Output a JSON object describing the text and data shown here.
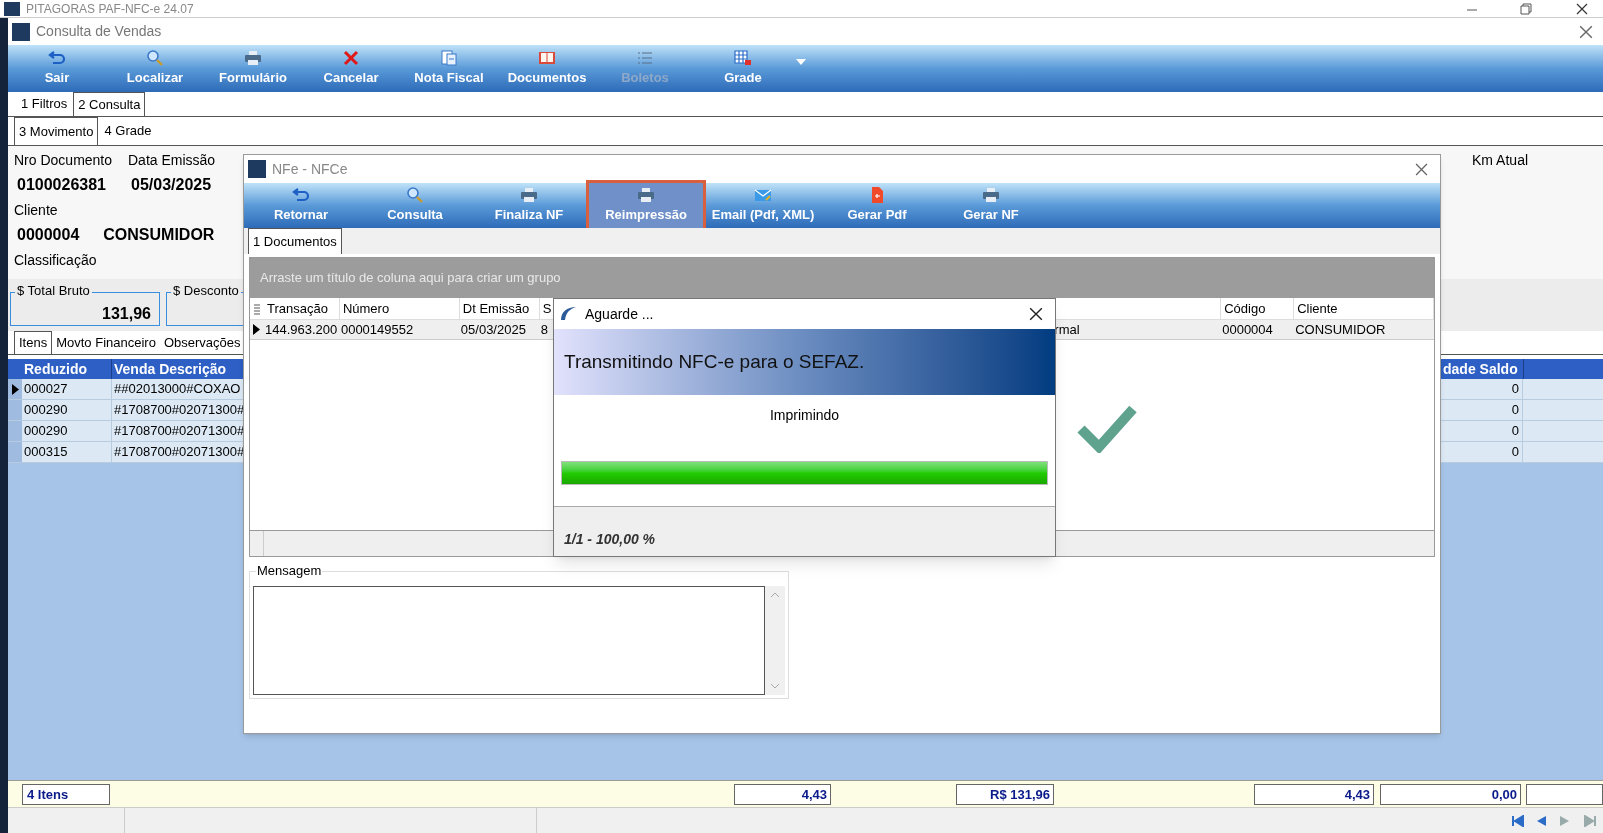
{
  "app_title_bar": {
    "title": "PITAGORAS PAF-NFC-e 24.07"
  },
  "window": {
    "title": "Consulta de Vendas"
  },
  "toolbar": [
    {
      "label": "Sair",
      "kind": "undo",
      "disabled": false
    },
    {
      "label": "Localizar",
      "kind": "search",
      "disabled": false
    },
    {
      "label": "Formulário",
      "kind": "printer",
      "disabled": false
    },
    {
      "label": "Cancelar",
      "kind": "cross",
      "disabled": false
    },
    {
      "label": "Nota Fiscal",
      "kind": "document",
      "disabled": false
    },
    {
      "label": "Documentos",
      "kind": "book",
      "disabled": false
    },
    {
      "label": "Boletos",
      "kind": "list",
      "disabled": true
    },
    {
      "label": "Grade",
      "kind": "grid",
      "disabled": false
    }
  ],
  "tabs": [
    {
      "label": "1 Filtros",
      "selected": false
    },
    {
      "label": "2 Consulta",
      "selected": true
    }
  ],
  "subtabs": [
    {
      "label": "3 Movimento",
      "selected": true
    },
    {
      "label": "4 Grade",
      "selected": false
    }
  ],
  "document": {
    "nro_label": "Nro Documento",
    "nro_value": "0100026381",
    "data_label": "Data Emissão",
    "data_value": "05/03/2025",
    "cliente_label": "Cliente",
    "cliente_code": "0000004",
    "cliente_name": "CONSUMIDOR",
    "classificacao_label": "Classificação",
    "km_label": "Km Atual"
  },
  "totals": [
    {
      "label": "$ Total Bruto",
      "value": "131,96"
    },
    {
      "label": "$ Desconto"
    }
  ],
  "item_tabs": [
    {
      "label": "Itens",
      "selected": true
    },
    {
      "label": "Movto Financeiro",
      "selected": false
    },
    {
      "label": "Observações",
      "selected": false
    }
  ],
  "items_grid": {
    "columns": [
      "Reduzido",
      "Venda Descrição",
      "dade Saldo"
    ],
    "rows": [
      {
        "selected": true,
        "reduzido": "000027",
        "descricao": "##02013000#COXAO",
        "saldo": "0"
      },
      {
        "selected": false,
        "reduzido": "000290",
        "descricao": "#1708700#02071300#",
        "saldo": "0"
      },
      {
        "selected": false,
        "reduzido": "000290",
        "descricao": "#1708700#02071300#",
        "saldo": "0"
      },
      {
        "selected": false,
        "reduzido": "000315",
        "descricao": "#1708700#02071300#",
        "saldo": "0"
      }
    ]
  },
  "footer_totals": [
    "4 Itens",
    "4,43",
    "R$ 131,96",
    "4,43",
    "0,00"
  ],
  "nfe_dialog": {
    "title": "NFe - NFCe",
    "toolbar": [
      {
        "label": "Retornar",
        "kind": "undo",
        "highlighted": false
      },
      {
        "label": "Consulta",
        "kind": "search",
        "highlighted": false
      },
      {
        "label": "Finaliza NF",
        "kind": "printer",
        "highlighted": false
      },
      {
        "label": "Reimpressão",
        "kind": "printer",
        "highlighted": true
      },
      {
        "label": "Email (Pdf, XML)",
        "kind": "mail",
        "highlighted": false
      },
      {
        "label": "Gerar Pdf",
        "kind": "pdf",
        "highlighted": false
      },
      {
        "label": "Gerar NF",
        "kind": "printer",
        "highlighted": false
      }
    ],
    "tabs": [
      {
        "label": "1 Documentos",
        "selected": true
      }
    ],
    "group_hint": "Arraste um título de coluna aqui para criar um grupo",
    "columns": [
      "Transação",
      "Número",
      "Dt Emissão",
      "S",
      "",
      "Código",
      "Cliente"
    ],
    "rows": [
      {
        "selected": true,
        "cells": [
          "144.963.200",
          "0000149552",
          "05/03/2025",
          "8",
          "rmal",
          "0000004",
          "CONSUMIDOR"
        ]
      }
    ],
    "message_label": "Mensagem"
  },
  "progress_dialog": {
    "title": "Aguarde ...",
    "banner": "Transmitindo NFC-e para o SEFAZ.",
    "status": "Imprimindo",
    "level": 1,
    "footer": "1/1 - 100,00 %"
  }
}
